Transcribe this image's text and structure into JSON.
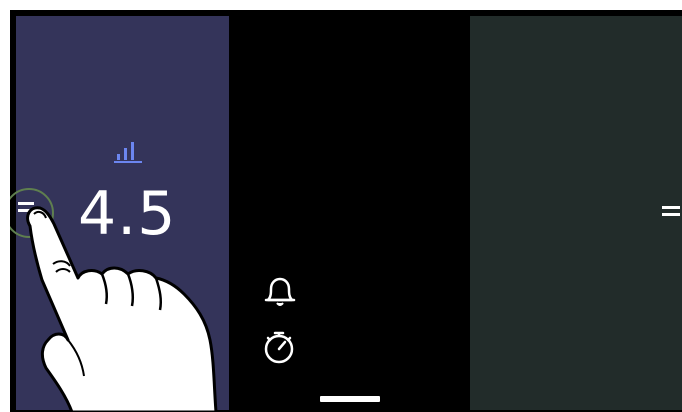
{
  "tile": {
    "value": "4.5",
    "signal_icon": "signal-strength-icon",
    "drag_handle_icon": "drag-handle-icon"
  },
  "quick_actions": {
    "bell_icon": "bell-icon",
    "timer_icon": "timer-icon"
  },
  "next_tile": {
    "drag_handle_icon": "drag-handle-icon"
  },
  "nav": {
    "home_indicator": "home-indicator"
  },
  "gesture": {
    "hand_icon": "pointing-hand-icon"
  },
  "colors": {
    "left_panel": "#34345a",
    "right_panel": "#222c2a",
    "accent_blue": "#6c86f0",
    "background": "#000000"
  }
}
